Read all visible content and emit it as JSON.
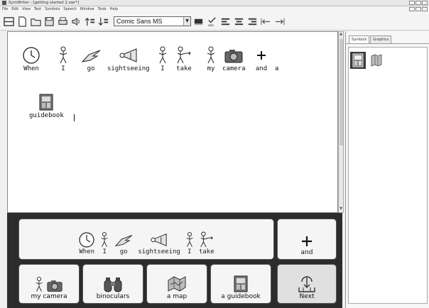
{
  "window": {
    "title": "SymWriter - [getting started 2.swr*]"
  },
  "menu": [
    "File",
    "Edit",
    "View",
    "Text",
    "Symbols",
    "Speech",
    "Window",
    "Tools",
    "Help"
  ],
  "toolbar": {
    "font_name": "Comic Sans MS",
    "buttons": [
      "layout-icon",
      "new-document-icon",
      "open-folder-icon",
      "save-icon",
      "print-icon",
      "speaker-icon",
      "increase-size-icon",
      "decrease-size-icon",
      "text-color-icon",
      "spellcheck-icon",
      "align-left-icon",
      "align-center-icon",
      "align-right-icon",
      "indent-left-icon",
      "indent-right-icon"
    ]
  },
  "document": {
    "line1": [
      {
        "word": "When",
        "icon": "clock-icon"
      },
      {
        "word": "I",
        "icon": "person-icon"
      },
      {
        "word": "go",
        "icon": "pointing-hand-icon"
      },
      {
        "word": "sightseeing",
        "icon": "looking-icon"
      },
      {
        "word": "I",
        "icon": "person-icon"
      },
      {
        "word": "take",
        "icon": "take-icon"
      },
      {
        "word": "my",
        "icon": "person-my-icon"
      },
      {
        "word": "camera",
        "icon": "camera-icon"
      },
      {
        "word": "and",
        "icon": "plus-icon"
      },
      {
        "word": "a",
        "icon": "none"
      }
    ],
    "line2": [
      {
        "word": "guidebook",
        "icon": "guidebook-icon"
      }
    ]
  },
  "side_panel": {
    "tabs": [
      "Symbols",
      "Graphics"
    ],
    "thumbnails": [
      "guidebook-icon",
      "map-icon"
    ]
  },
  "grid": {
    "sentence_cell": [
      {
        "word": "When",
        "icon": "clock-icon"
      },
      {
        "word": "I",
        "icon": "person-icon"
      },
      {
        "word": "go",
        "icon": "pointing-hand-icon"
      },
      {
        "word": "sightseeing",
        "icon": "looking-icon"
      },
      {
        "word": "I",
        "icon": "person-icon"
      },
      {
        "word": "take",
        "icon": "take-icon"
      }
    ],
    "and_cell": "and",
    "bottom_cells": [
      {
        "label": "my camera",
        "icon": "person-camera-icon"
      },
      {
        "label": "binoculars",
        "icon": "binoculars-icon"
      },
      {
        "label": "a map",
        "icon": "map-icon"
      },
      {
        "label": "a guidebook",
        "icon": "guidebook-icon"
      },
      {
        "label": "Next",
        "icon": "next-icon"
      }
    ]
  }
}
